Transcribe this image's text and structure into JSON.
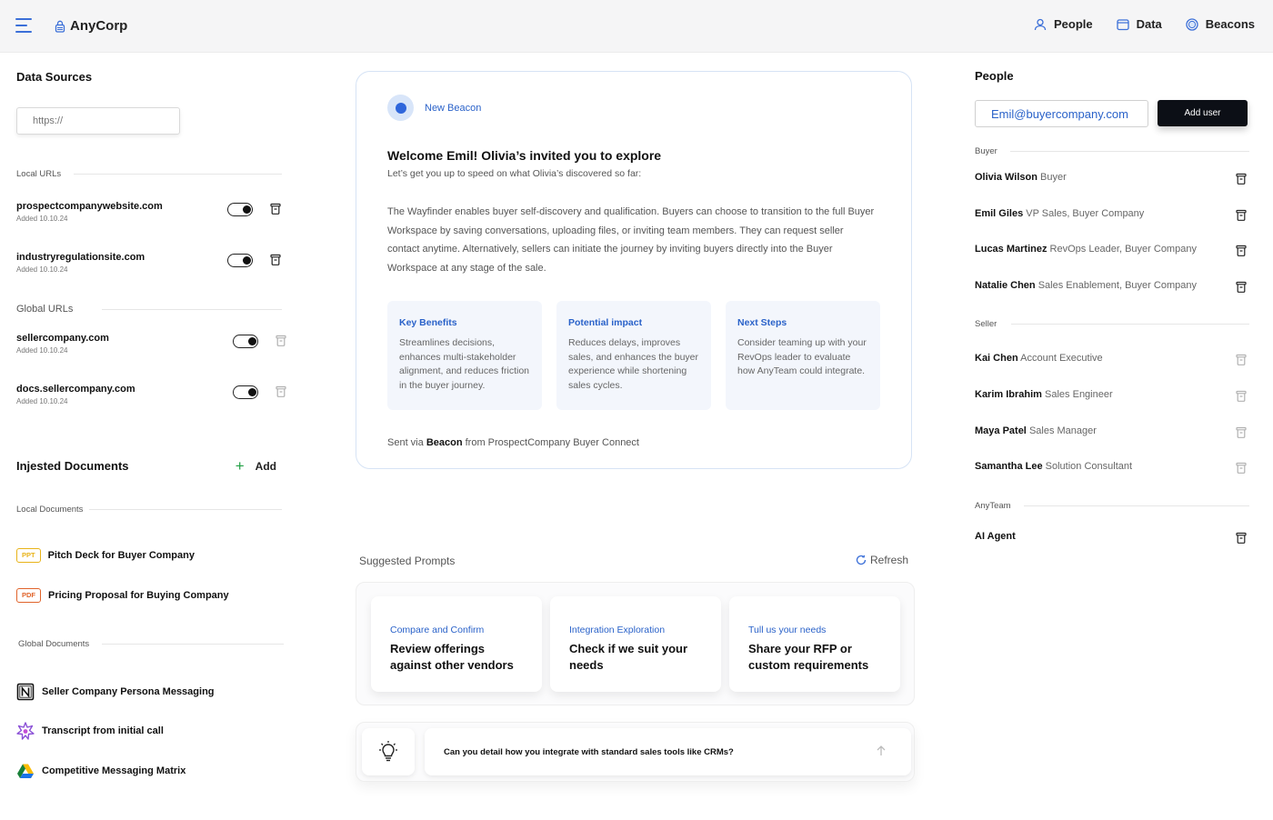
{
  "header": {
    "brand": "AnyCorp",
    "nav": [
      {
        "label": "People",
        "icon": "user-icon"
      },
      {
        "label": "Data",
        "icon": "folder-icon"
      },
      {
        "label": "Beacons",
        "icon": "beacon-icon"
      }
    ]
  },
  "data_sources": {
    "title": "Data Sources",
    "url_placeholder": "https://",
    "local_urls_label": "Local URLs",
    "global_urls_label": "Global URLs",
    "local_urls": [
      {
        "name": "prospectcompanywebsite.com",
        "date": "Added 10.10.24",
        "enabled": true
      },
      {
        "name": "industryregulationsite.com",
        "date": "Added 10.10.24",
        "enabled": true
      }
    ],
    "global_urls": [
      {
        "name": "sellercompany.com",
        "date": "Added 10.10.24",
        "enabled": true
      },
      {
        "name": "docs.sellercompany.com",
        "date": "Added 10.10.24",
        "enabled": true
      }
    ]
  },
  "documents": {
    "title": "Injested Documents",
    "add_label": "Add",
    "local_label": "Local Documents",
    "global_label": "Global Documents",
    "local": [
      {
        "tag": "PPT",
        "name": "Pitch Deck for Buyer Company"
      },
      {
        "tag": "PDF",
        "name": "Pricing Proposal for Buying Company"
      }
    ],
    "global": [
      {
        "icon": "notion-icon",
        "name": "Seller Company Persona Messaging"
      },
      {
        "icon": "transcript-icon",
        "name": "Transcript from initial call"
      },
      {
        "icon": "google-drive-icon",
        "name": "Competitive Messaging Matrix"
      }
    ]
  },
  "beacon": {
    "label": "New Beacon",
    "title": "Welcome Emil! Olivia’s invited you to explore",
    "subtitle": "Let’s get you up to speed on what Olivia’s discovered so far:",
    "body": "The Wayfinder enables buyer self-discovery and qualification. Buyers can choose to transition to the full Buyer Workspace by saving conversations, uploading files, or inviting team members. They can request seller contact anytime. Alternatively, sellers can initiate the journey by inviting buyers directly into the Buyer Workspace at any stage of the sale.",
    "cards": [
      {
        "title": "Key Benefits",
        "text": "Streamlines decisions, enhances multi-stakeholder alignment, and reduces friction in the buyer journey."
      },
      {
        "title": "Potential impact",
        "text": "Reduces delays, improves sales, and enhances the buyer experience while shortening sales cycles."
      },
      {
        "title": "Next Steps",
        "text": "Consider teaming up with your RevOps leader to evaluate how AnyTeam could integrate."
      }
    ],
    "footer_prefix": "Sent via ",
    "footer_brand": "Beacon",
    "footer_suffix": " from ProspectCompany Buyer Connect"
  },
  "prompts": {
    "label": "Suggested Prompts",
    "refresh_label": "Refresh",
    "items": [
      {
        "category": "Compare and Confirm",
        "text": "Review offerings against other vendors"
      },
      {
        "category": "Integration Exploration",
        "text": "Check if we suit your needs"
      },
      {
        "category": "Tull us your needs",
        "text": "Share your RFP or custom requirements"
      }
    ],
    "chat_value": "Can you detail how you integrate with standard sales tools like CRMs?"
  },
  "people": {
    "title": "People",
    "email_value": "Emil@buyercompany.com",
    "add_user_label": "Add user",
    "groups": [
      {
        "label": "Buyer",
        "members": [
          {
            "name": "Olivia Wilson",
            "role": "Buyer"
          },
          {
            "name": "Emil Giles",
            "role": "VP Sales, Buyer Company"
          },
          {
            "name": "Lucas Martinez",
            "role": "RevOps Leader, Buyer Company"
          },
          {
            "name": "Natalie Chen",
            "role": "Sales Enablement, Buyer Company"
          }
        ]
      },
      {
        "label": "Seller",
        "members": [
          {
            "name": "Kai Chen",
            "role": "Account Executive"
          },
          {
            "name": "Karim Ibrahim",
            "role": "Sales Engineer"
          },
          {
            "name": "Maya Patel",
            "role": "Sales Manager"
          },
          {
            "name": "Samantha Lee",
            "role": "Solution Consultant"
          }
        ]
      },
      {
        "label": "AnyTeam",
        "members": [
          {
            "name": "AI Agent",
            "role": ""
          }
        ]
      }
    ]
  },
  "colors": {
    "accent": "#2a62c9",
    "toggle": "#111111",
    "add_green": "#22a045",
    "ppt": "#e8b318",
    "pdf": "#e0632a"
  }
}
